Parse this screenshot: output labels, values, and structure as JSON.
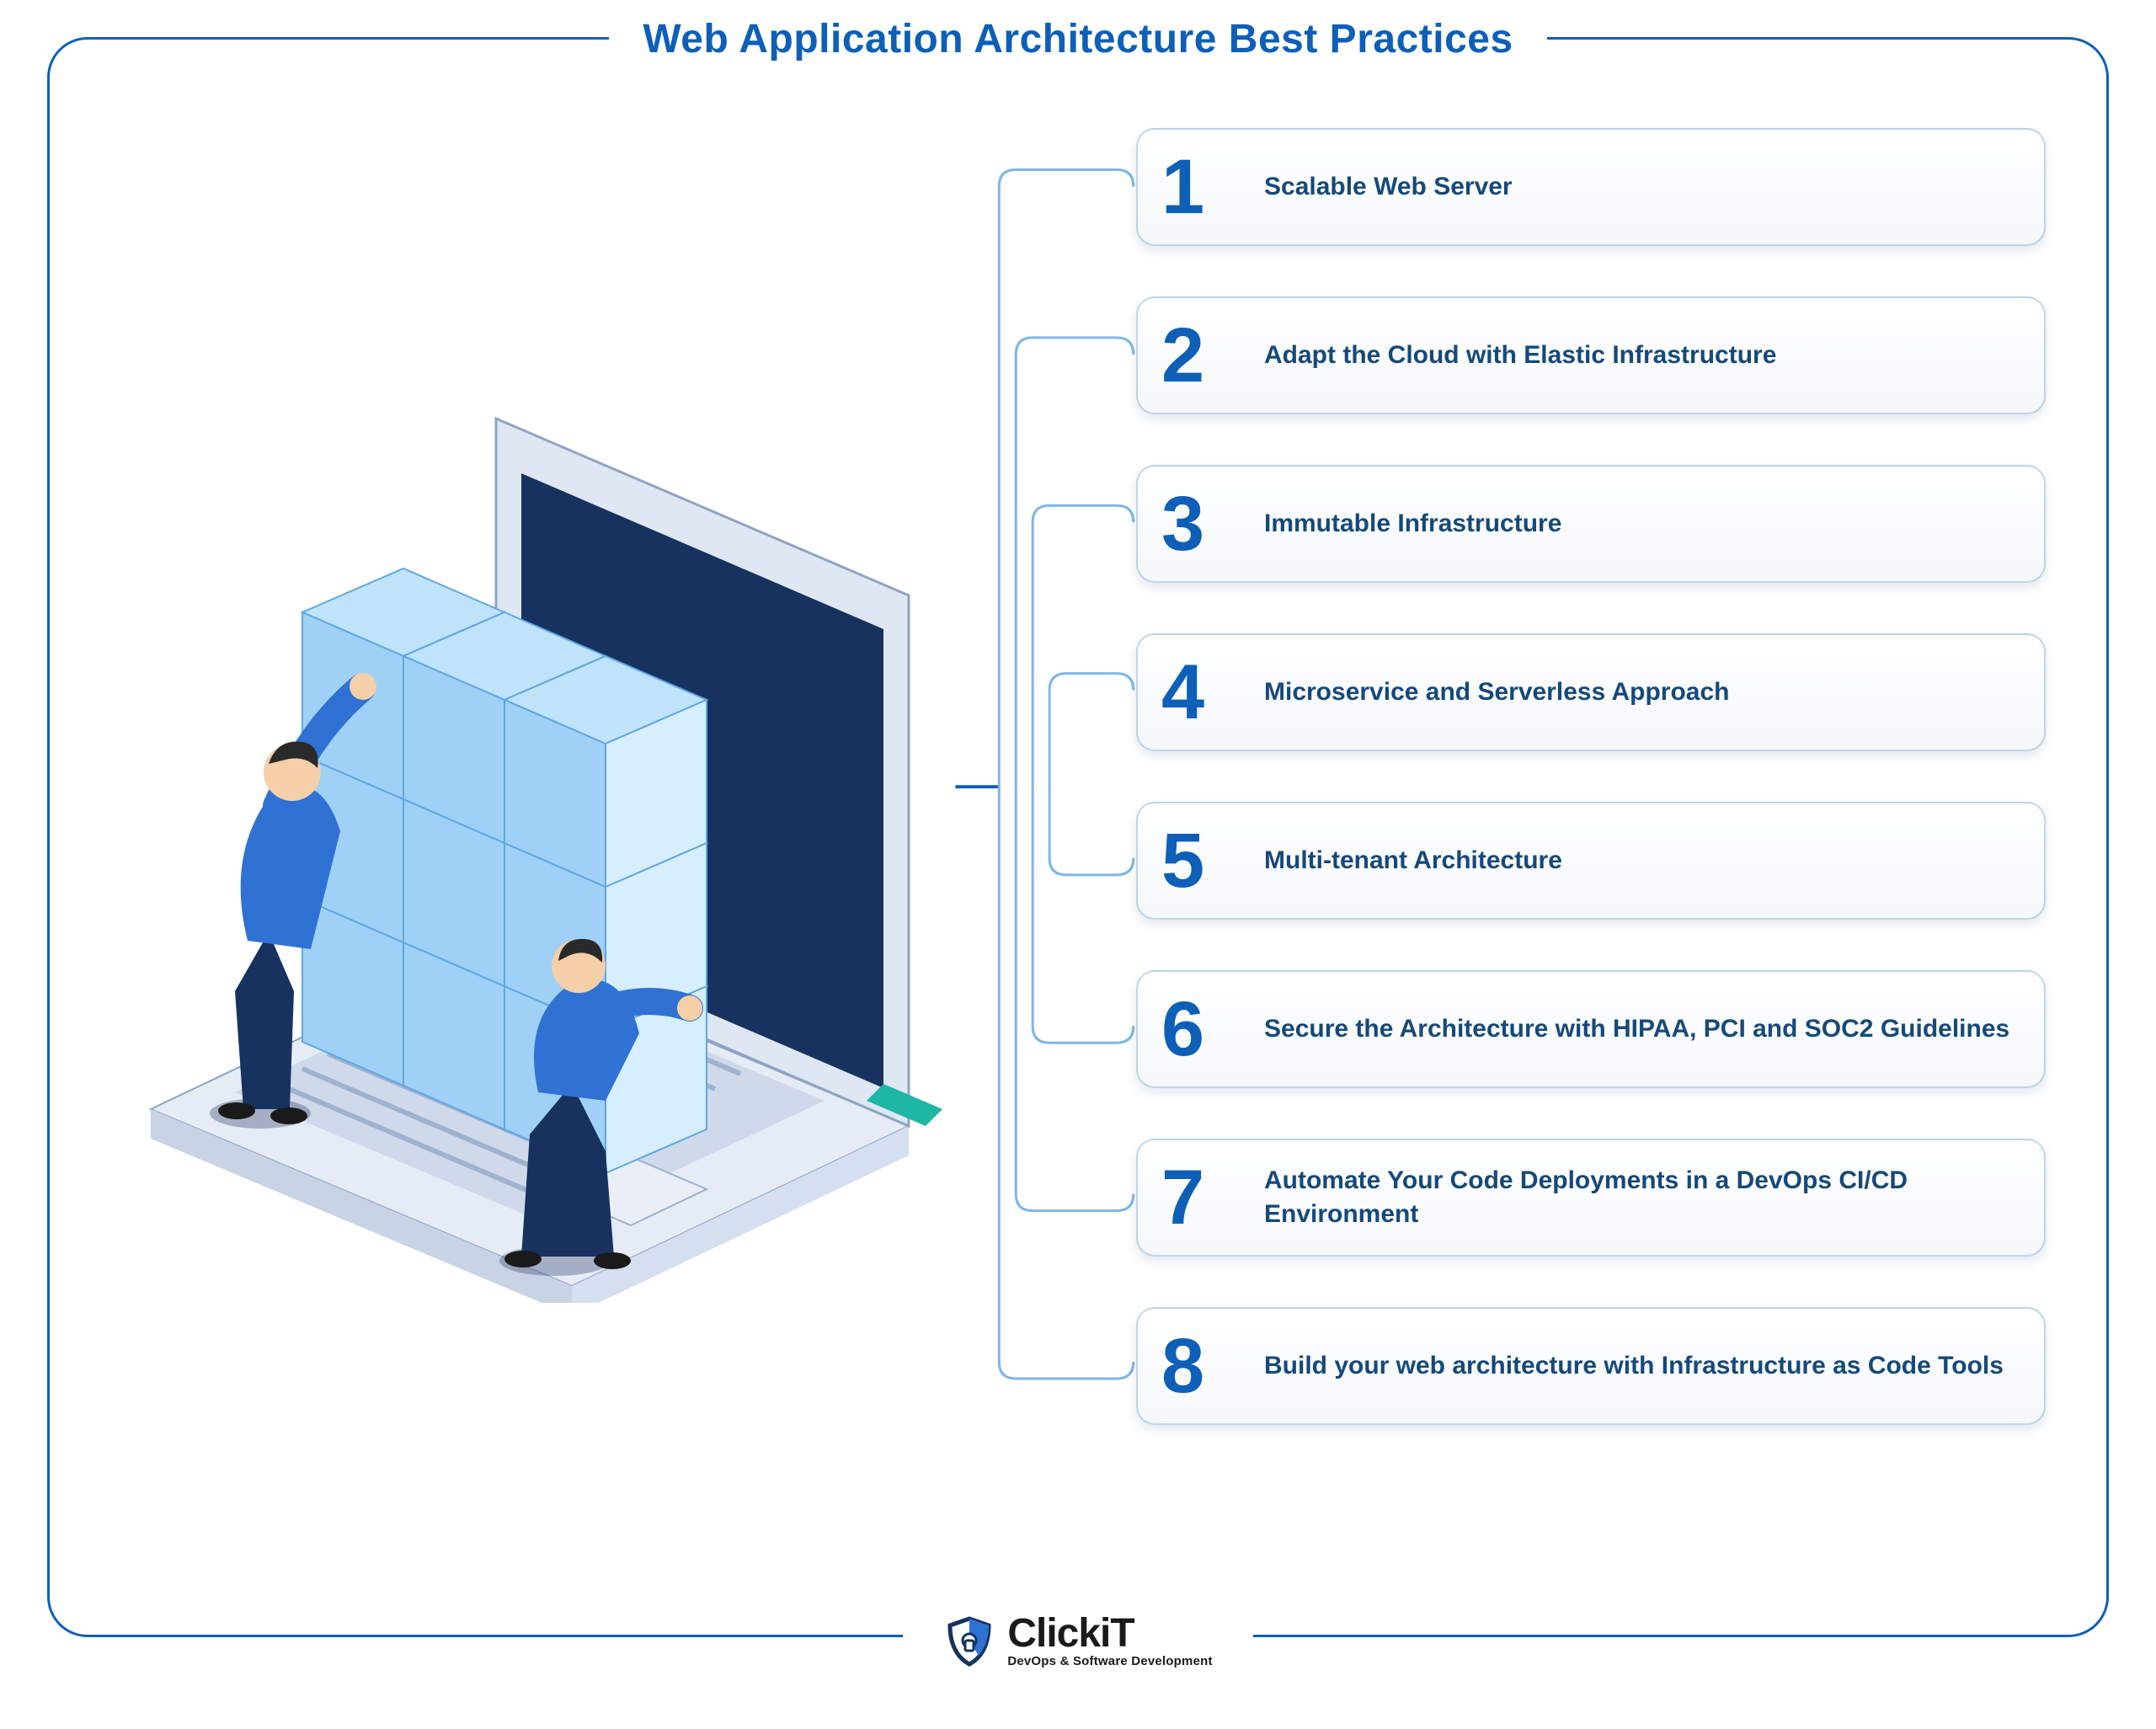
{
  "title": "Web Application Architecture Best Practices",
  "practices": [
    {
      "number": "1",
      "label": "Scalable Web Server"
    },
    {
      "number": "2",
      "label": "Adapt the Cloud with Elastic Infrastructure"
    },
    {
      "number": "3",
      "label": "Immutable Infrastructure"
    },
    {
      "number": "4",
      "label": "Microservice and Serverless Approach"
    },
    {
      "number": "5",
      "label": "Multi-tenant Architecture"
    },
    {
      "number": "6",
      "label": "Secure the Architecture with HIPAA, PCI and SOC2 Guidelines"
    },
    {
      "number": "7",
      "label": "Automate Your Code Deployments in a DevOps CI/CD Environment"
    },
    {
      "number": "8",
      "label": "Build your web architecture with Infrastructure as Code Tools"
    }
  ],
  "logo": {
    "main": "ClickiT",
    "tagline": "DevOps & Software Development"
  },
  "illustration": {
    "description": "isometric-laptop-with-cube-grid-and-two-people"
  }
}
